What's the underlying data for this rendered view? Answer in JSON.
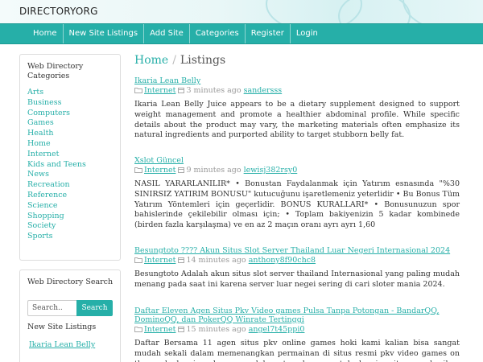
{
  "header": {
    "brand": "DIRECTORYORG"
  },
  "nav": {
    "items": [
      "Home",
      "New Site Listings",
      "Add Site",
      "Categories",
      "Register",
      "Login"
    ]
  },
  "sidebar": {
    "categories_title": "Web Directory Categories",
    "categories": [
      "Arts",
      "Business",
      "Computers",
      "Games",
      "Health",
      "Home",
      "Internet",
      "Kids and Teens",
      "News",
      "Recreation",
      "Reference",
      "Science",
      "Shopping",
      "Society",
      "Sports"
    ],
    "search_title": "Web Directory Search",
    "search_placeholder": "Search..",
    "search_button": "Search",
    "new_listings_title": "New Site Listings",
    "new_listings": [
      "Ikaria Lean Belly"
    ]
  },
  "breadcrumb": {
    "home": "Home",
    "sep": "/",
    "current": "Listings"
  },
  "listings": [
    {
      "title": "Ikaria Lean Belly",
      "category": "Internet",
      "time": "3 minutes ago",
      "user": "sandersss",
      "description": "Ikaria Lean Belly Juice appears to be a dietary supplement designed to support weight management and promote a healthier abdominal profile. While specific details about the product may vary, the marketing materials often emphasize its natural ingredients and purported ability to target stubborn belly fat."
    },
    {
      "title": "Xslot Güncel",
      "category": "Internet",
      "time": "9 minutes ago",
      "user": "lewisj382rsy0",
      "description": "NASIL YARARLANILIR* • Bonustan Faydalanmak için Yatırım esnasında \"%30 SINIRSIZ YATIRIM BONUSU\" kutucuğunu işaretlemeniz yeterlidir • Bu Bonus Tüm Yatırım Yöntemleri için geçerlidir. BONUS KURALLARI* • Bonusunuzun spor bahislerinde çekilebilir olması için; • Toplam bakiyenizin 5 kadar kombinede (birden fazla karşılaşma) ve en az 2 maçın oranı ayrı ayrı 1,60"
    },
    {
      "title": "Besungtoto ???? Akun Situs Slot Server Thailand Luar Negeri Internasional 2024",
      "category": "Internet",
      "time": "14 minutes ago",
      "user": "anthony8f90chc8",
      "description": "Besungtoto Adalah akun situs slot server thailand Internasional yang paling mudah menang pada saat ini karena server luar negei sering di cari sloter mania 2024."
    },
    {
      "title": "Daftar Eleven Agen Situs Pkv Video games Pulsa Tanpa Potongan - BandarQQ, DominoQQ, dan PokerQQ Winrate Tertinggi",
      "category": "Internet",
      "time": "15 minutes ago",
      "user": "angel7t45ppi0",
      "description": "Daftar Bersama 11 agen situs pkv online games hoki kami kalian bisa sangat mudah sekali dalam memenangkan permainan di situs resmi pkv video games on the web kami, sekarang salah satu alasan untuk kami yaitu memberikan kepercayaan kepada setiap"
    }
  ]
}
